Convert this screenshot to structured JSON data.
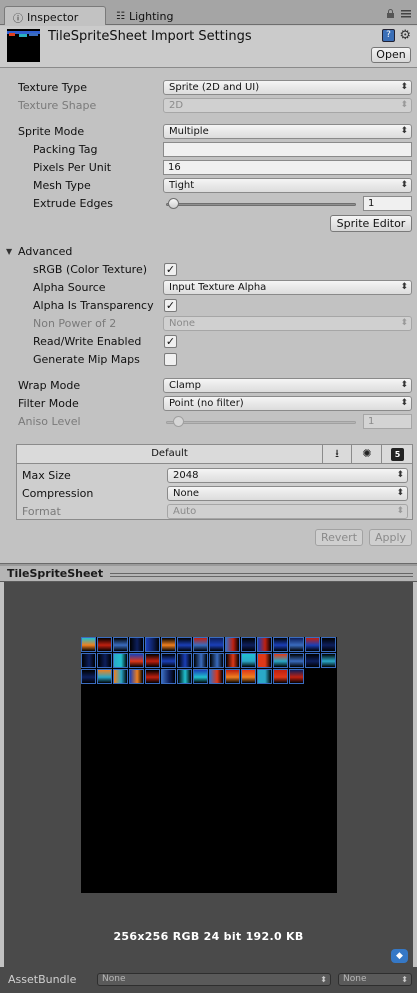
{
  "tabs": [
    {
      "label": "Inspector",
      "icon": "info-icon"
    },
    {
      "label": "Lighting",
      "icon": "lighting-icon"
    }
  ],
  "header": {
    "title": "TileSpriteSheet Import Settings",
    "open_label": "Open"
  },
  "fields": {
    "texture_type": {
      "label": "Texture Type",
      "value": "Sprite (2D and UI)"
    },
    "texture_shape": {
      "label": "Texture Shape",
      "value": "2D"
    },
    "sprite_mode": {
      "label": "Sprite Mode",
      "value": "Multiple"
    },
    "packing_tag": {
      "label": "Packing Tag",
      "value": ""
    },
    "pixels_per_unit": {
      "label": "Pixels Per Unit",
      "value": "16"
    },
    "mesh_type": {
      "label": "Mesh Type",
      "value": "Tight"
    },
    "extrude_edges": {
      "label": "Extrude Edges",
      "value": "1",
      "slider_fraction": 0.031
    },
    "sprite_editor_label": "Sprite Editor",
    "advanced_label": "Advanced",
    "srgb": {
      "label": "sRGB (Color Texture)",
      "checked": true
    },
    "alpha_source": {
      "label": "Alpha Source",
      "value": "Input Texture Alpha"
    },
    "alpha_is_transparency": {
      "label": "Alpha Is Transparency",
      "checked": true
    },
    "non_power_of_2": {
      "label": "Non Power of 2",
      "value": "None"
    },
    "read_write": {
      "label": "Read/Write Enabled",
      "checked": true
    },
    "generate_mip_maps": {
      "label": "Generate Mip Maps",
      "checked": false
    },
    "wrap_mode": {
      "label": "Wrap Mode",
      "value": "Clamp"
    },
    "filter_mode": {
      "label": "Filter Mode",
      "value": "Point (no filter)"
    },
    "aniso_level": {
      "label": "Aniso Level",
      "value": "1"
    }
  },
  "platform": {
    "default_label": "Default",
    "tab_icons": [
      "download-icon",
      "android-icon",
      "html5-icon"
    ],
    "html5_text": "5",
    "max_size": {
      "label": "Max Size",
      "value": "2048"
    },
    "compression": {
      "label": "Compression",
      "value": "None"
    },
    "format": {
      "label": "Format",
      "value": "Auto"
    }
  },
  "actions": {
    "revert_label": "Revert",
    "apply_label": "Apply"
  },
  "preview": {
    "title": "TileSpriteSheet",
    "info": "256x256  RGB 24 bit   192.0 KB"
  },
  "assetbundle": {
    "label": "AssetBundle",
    "name_value": "None",
    "variant_value": "None"
  },
  "colors": {
    "accent_blue": "#3a6cbf",
    "panel": "#c2c2c2",
    "preview_bg": "#4a4a4a"
  }
}
